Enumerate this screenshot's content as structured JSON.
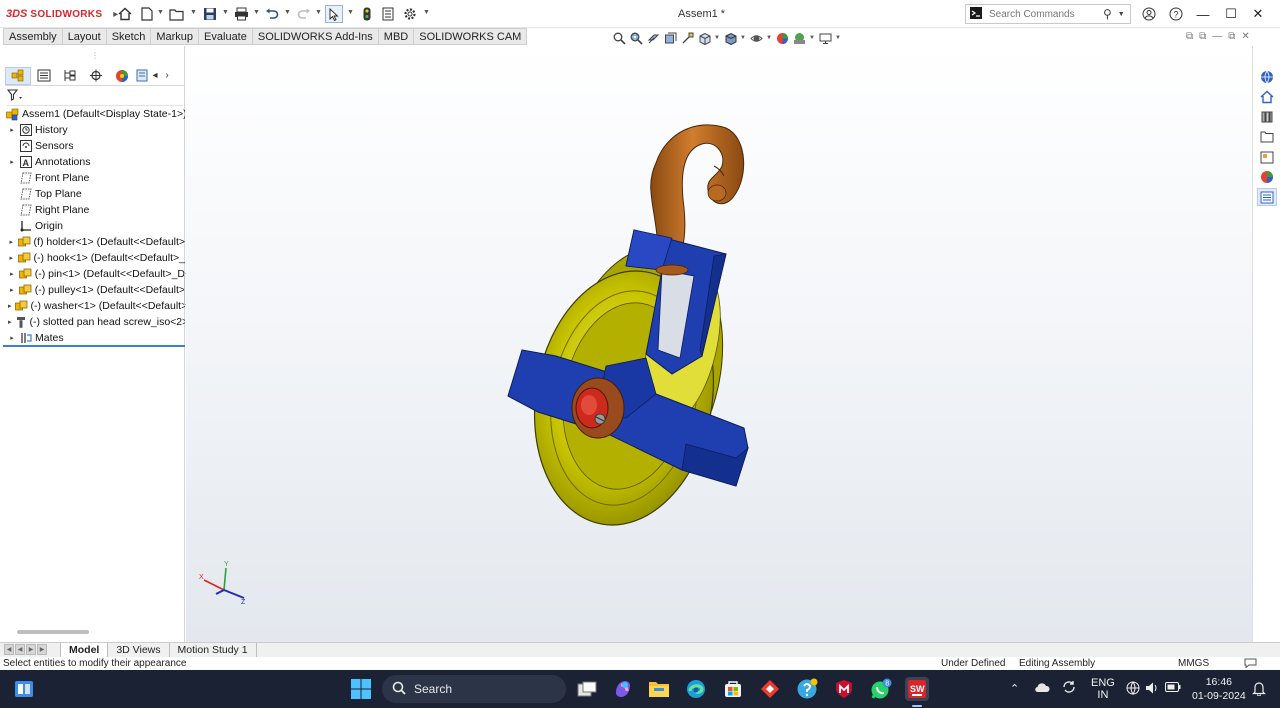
{
  "app": {
    "brand_prefix": "3DS",
    "brand_name": "SOLIDWORKS",
    "document_title": "Assem1 *"
  },
  "search": {
    "placeholder": "Search Commands"
  },
  "command_tabs": [
    "Assembly",
    "Layout",
    "Sketch",
    "Markup",
    "Evaluate",
    "SOLIDWORKS Add-Ins",
    "MBD",
    "SOLIDWORKS CAM"
  ],
  "feature_tree": {
    "root": "Assem1  (Default<Display State-1>)",
    "items": [
      {
        "label": "History",
        "icon": "history-icon",
        "expandable": true
      },
      {
        "label": "Sensors",
        "icon": "sensors-icon",
        "expandable": false
      },
      {
        "label": "Annotations",
        "icon": "annotations-icon",
        "expandable": true
      },
      {
        "label": "Front Plane",
        "icon": "plane-icon",
        "expandable": false
      },
      {
        "label": "Top Plane",
        "icon": "plane-icon",
        "expandable": false
      },
      {
        "label": "Right Plane",
        "icon": "plane-icon",
        "expandable": false
      },
      {
        "label": "Origin",
        "icon": "origin-icon",
        "expandable": false
      },
      {
        "label": "(f) holder<1> (Default<<Default>",
        "icon": "part-icon",
        "expandable": true
      },
      {
        "label": "(-) hook<1> (Default<<Default>_",
        "icon": "part-icon",
        "expandable": true
      },
      {
        "label": "(-) pin<1> (Default<<Default>_D",
        "icon": "part-icon",
        "expandable": true
      },
      {
        "label": "(-) pulley<1> (Default<<Default>",
        "icon": "part-icon",
        "expandable": true
      },
      {
        "label": "(-) washer<1> (Default<<Default>",
        "icon": "part-icon",
        "expandable": true
      },
      {
        "label": "(-) slotted pan head screw_iso<2>",
        "icon": "toolbox-screw-icon",
        "expandable": true
      },
      {
        "label": "Mates",
        "icon": "mates-icon",
        "expandable": true
      }
    ]
  },
  "bottom_tabs": [
    "Model",
    "3D Views",
    "Motion Study 1"
  ],
  "status": {
    "message": "Select entities to modify their appearance",
    "state": "Under Defined",
    "mode": "Editing Assembly",
    "units": "MMGS"
  },
  "triad": {
    "x": "X",
    "y": "Y",
    "z": "Z"
  },
  "taskbar": {
    "search_label": "Search",
    "lang_line1": "ENG",
    "lang_line2": "IN",
    "time": "16:46",
    "date": "01-09-2024",
    "whatsapp_badge": "8"
  },
  "colors": {
    "accent": "#3a7fd0",
    "holder": "#1f3fb0",
    "pulley": "#c8c400",
    "hook": "#b5651d",
    "pin": "#cc2a1c",
    "washer": "#9a4b1e",
    "taskbar": "#1a2233"
  }
}
